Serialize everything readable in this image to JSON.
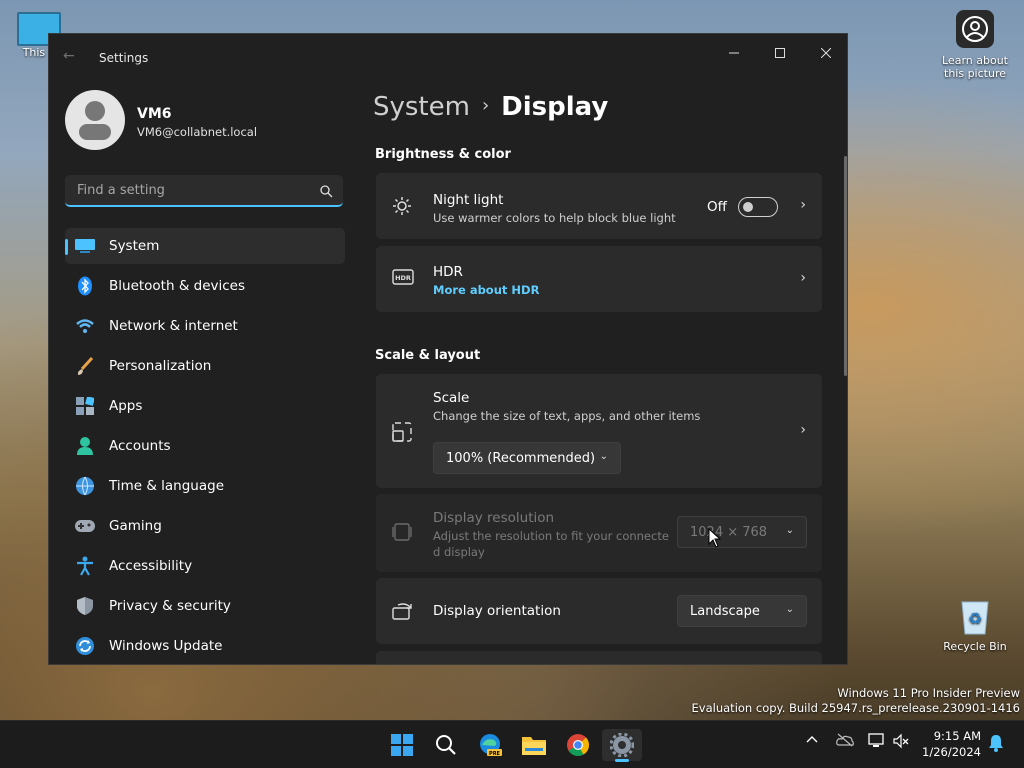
{
  "desktop": {
    "icons": [
      {
        "label": "This P"
      },
      {
        "label": "Learn about this picture"
      },
      {
        "label": "Recycle Bin"
      }
    ],
    "watermark": {
      "line1": "Windows 11 Pro Insider Preview",
      "line2": "Evaluation copy. Build 25947.rs_prerelease.230901-1416"
    }
  },
  "window": {
    "title": "Settings",
    "controls": {
      "minimize": "minimize-icon",
      "maximize": "maximize-icon",
      "close": "close-icon"
    }
  },
  "profile": {
    "name": "VM6",
    "email": "VM6@collabnet.local"
  },
  "search": {
    "placeholder": "Find a setting"
  },
  "sidebar": {
    "items": [
      {
        "label": "System",
        "icon": "monitor-icon",
        "active": true
      },
      {
        "label": "Bluetooth & devices",
        "icon": "bluetooth-icon"
      },
      {
        "label": "Network & internet",
        "icon": "wifi-icon"
      },
      {
        "label": "Personalization",
        "icon": "brush-icon"
      },
      {
        "label": "Apps",
        "icon": "apps-icon"
      },
      {
        "label": "Accounts",
        "icon": "person-icon"
      },
      {
        "label": "Time & language",
        "icon": "globe-clock-icon"
      },
      {
        "label": "Gaming",
        "icon": "gamepad-icon"
      },
      {
        "label": "Accessibility",
        "icon": "accessibility-icon"
      },
      {
        "label": "Privacy & security",
        "icon": "shield-icon"
      },
      {
        "label": "Windows Update",
        "icon": "update-icon"
      }
    ]
  },
  "breadcrumb": {
    "parent": "System",
    "separator": "›",
    "current": "Display"
  },
  "sections": {
    "brightness": "Brightness & color",
    "scale_layout": "Scale & layout"
  },
  "night_light": {
    "title": "Night light",
    "subtitle": "Use warmer colors to help block blue light",
    "state": "Off"
  },
  "hdr": {
    "title": "HDR",
    "link": "More about HDR"
  },
  "scale": {
    "title": "Scale",
    "subtitle": "Change the size of text, apps, and other items",
    "value": "100% (Recommended)"
  },
  "resolution": {
    "title": "Display resolution",
    "subtitle_line1": "Adjust the resolution to fit your connecte",
    "subtitle_line2": "d display",
    "value": "1024 × 768"
  },
  "orientation": {
    "title": "Display orientation",
    "value": "Landscape"
  },
  "taskbar": {
    "apps": [
      "start-icon",
      "search-icon",
      "edge-pre-icon",
      "file-explorer-icon",
      "chrome-icon",
      "settings-icon"
    ],
    "clock": {
      "time": "9:15 AM",
      "date": "1/26/2024"
    }
  },
  "colors": {
    "accent": "#4cc2ff",
    "link": "#60cdff",
    "window_bg": "#202020",
    "card_bg": "#2b2b2b"
  }
}
